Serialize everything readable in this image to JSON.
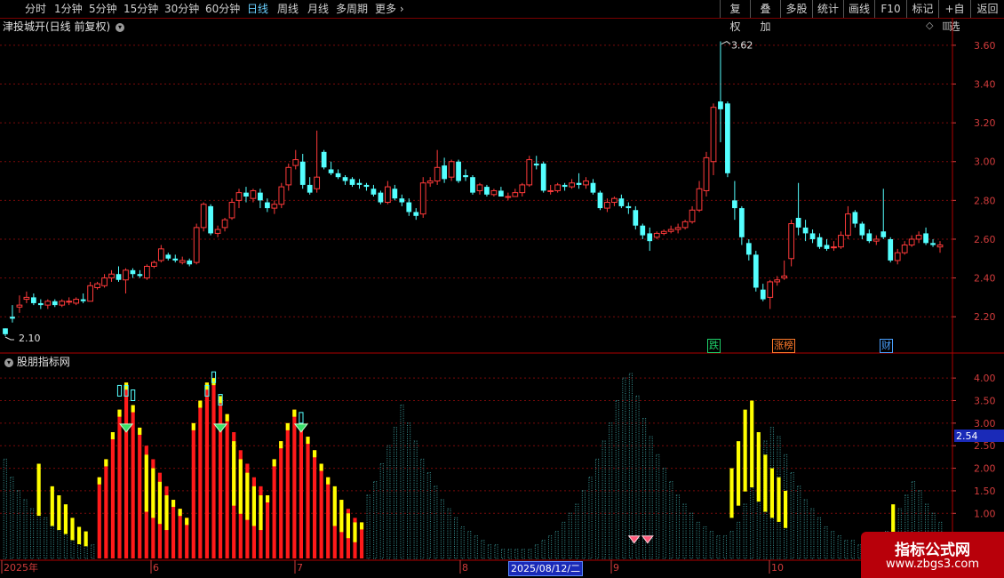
{
  "toolbar": {
    "left": [
      {
        "label": "分时",
        "active": false
      },
      {
        "label": "1分钟",
        "active": false
      },
      {
        "label": "5分钟",
        "active": false
      },
      {
        "label": "15分钟",
        "active": false
      },
      {
        "label": "30分钟",
        "active": false
      },
      {
        "label": "60分钟",
        "active": false
      },
      {
        "label": "日线",
        "active": true
      },
      {
        "label": "周线",
        "active": false
      },
      {
        "label": "月线",
        "active": false
      },
      {
        "label": "多周期",
        "active": false
      },
      {
        "label": "更多",
        "active": false
      }
    ],
    "right": [
      "复权",
      "叠加",
      "多股",
      "统计",
      "画线",
      "F10",
      "标记",
      "+自选",
      "返回"
    ]
  },
  "main_chart": {
    "title": "津投城开(日线 前复权)",
    "high_label": "3.62",
    "low_label": "2.10",
    "events": [
      {
        "text": "跌",
        "color": "#1fd06a"
      },
      {
        "text": "涨榜",
        "color": "#ff7a2a"
      },
      {
        "text": "财",
        "color": "#4aa0ff"
      }
    ]
  },
  "indicator": {
    "title": "股朋指标网",
    "current_value_label": "2.54"
  },
  "chart_data": [
    {
      "type": "candlestick",
      "title": "津投城开(日线 前复权)",
      "ylim": [
        2.1,
        3.65
      ],
      "yticks": [
        2.2,
        2.4,
        2.6,
        2.8,
        3.0,
        3.2,
        3.4,
        3.6
      ],
      "y_tick_labels": [
        "2.20",
        "2.40",
        "2.60",
        "2.80",
        "3.00",
        "3.20",
        "3.40",
        "3.60"
      ],
      "colors": {
        "up": "#ff3a3a",
        "down": "#54ffff"
      },
      "candles": [
        [
          2.14,
          2.14,
          2.11,
          2.1
        ],
        [
          2.2,
          2.26,
          2.19,
          2.17
        ],
        [
          2.25,
          2.31,
          2.26,
          2.22
        ],
        [
          2.29,
          2.33,
          2.3,
          2.27
        ],
        [
          2.3,
          2.32,
          2.27,
          2.26
        ],
        [
          2.27,
          2.29,
          2.26,
          2.24
        ],
        [
          2.26,
          2.29,
          2.28,
          2.24
        ],
        [
          2.28,
          2.29,
          2.26,
          2.25
        ],
        [
          2.26,
          2.29,
          2.28,
          2.25
        ],
        [
          2.28,
          2.3,
          2.28,
          2.26
        ],
        [
          2.27,
          2.3,
          2.29,
          2.26
        ],
        [
          2.29,
          2.32,
          2.28,
          2.27
        ],
        [
          2.28,
          2.38,
          2.36,
          2.28
        ],
        [
          2.35,
          2.38,
          2.37,
          2.34
        ],
        [
          2.36,
          2.42,
          2.4,
          2.35
        ],
        [
          2.4,
          2.44,
          2.42,
          2.38
        ],
        [
          2.42,
          2.46,
          2.39,
          2.38
        ],
        [
          2.39,
          2.45,
          2.44,
          2.32
        ],
        [
          2.44,
          2.45,
          2.42,
          2.4
        ],
        [
          2.42,
          2.44,
          2.41,
          2.4
        ],
        [
          2.4,
          2.47,
          2.46,
          2.39
        ],
        [
          2.46,
          2.49,
          2.48,
          2.45
        ],
        [
          2.49,
          2.57,
          2.55,
          2.48
        ],
        [
          2.52,
          2.53,
          2.5,
          2.49
        ],
        [
          2.5,
          2.52,
          2.49,
          2.48
        ],
        [
          2.48,
          2.51,
          2.49,
          2.47
        ],
        [
          2.49,
          2.5,
          2.47,
          2.46
        ],
        [
          2.48,
          2.68,
          2.66,
          2.47
        ],
        [
          2.66,
          2.79,
          2.78,
          2.64
        ],
        [
          2.77,
          2.78,
          2.63,
          2.62
        ],
        [
          2.63,
          2.67,
          2.65,
          2.61
        ],
        [
          2.66,
          2.71,
          2.7,
          2.64
        ],
        [
          2.71,
          2.81,
          2.79,
          2.7
        ],
        [
          2.8,
          2.86,
          2.84,
          2.76
        ],
        [
          2.84,
          2.87,
          2.82,
          2.79
        ],
        [
          2.81,
          2.86,
          2.85,
          2.79
        ],
        [
          2.84,
          2.86,
          2.8,
          2.76
        ],
        [
          2.79,
          2.81,
          2.76,
          2.74
        ],
        [
          2.76,
          2.8,
          2.78,
          2.73
        ],
        [
          2.78,
          2.89,
          2.87,
          2.76
        ],
        [
          2.88,
          2.99,
          2.97,
          2.85
        ],
        [
          2.98,
          3.06,
          3.01,
          2.96
        ],
        [
          3.0,
          3.04,
          2.88,
          2.86
        ],
        [
          2.88,
          2.92,
          2.84,
          2.83
        ],
        [
          2.86,
          3.16,
          2.92,
          2.84
        ],
        [
          3.05,
          3.06,
          2.97,
          2.96
        ],
        [
          2.96,
          3.0,
          2.94,
          2.93
        ],
        [
          2.94,
          2.96,
          2.92,
          2.91
        ],
        [
          2.92,
          2.93,
          2.9,
          2.88
        ],
        [
          2.91,
          2.92,
          2.88,
          2.87
        ],
        [
          2.89,
          2.91,
          2.88,
          2.86
        ],
        [
          2.88,
          2.89,
          2.87,
          2.85
        ],
        [
          2.86,
          2.88,
          2.83,
          2.82
        ],
        [
          2.84,
          2.85,
          2.79,
          2.78
        ],
        [
          2.79,
          2.9,
          2.87,
          2.78
        ],
        [
          2.86,
          2.88,
          2.81,
          2.8
        ],
        [
          2.81,
          2.83,
          2.79,
          2.77
        ],
        [
          2.79,
          2.81,
          2.74,
          2.72
        ],
        [
          2.74,
          2.76,
          2.72,
          2.7
        ],
        [
          2.73,
          2.92,
          2.89,
          2.71
        ],
        [
          2.89,
          2.92,
          2.9,
          2.87
        ],
        [
          2.9,
          3.06,
          2.97,
          2.88
        ],
        [
          2.98,
          3.02,
          2.91,
          2.89
        ],
        [
          2.92,
          3.01,
          3.0,
          2.9
        ],
        [
          3.0,
          3.01,
          2.9,
          2.89
        ],
        [
          2.93,
          2.96,
          2.92,
          2.9
        ],
        [
          2.92,
          2.93,
          2.84,
          2.83
        ],
        [
          2.85,
          2.89,
          2.88,
          2.83
        ],
        [
          2.87,
          2.88,
          2.83,
          2.82
        ],
        [
          2.83,
          2.86,
          2.85,
          2.82
        ],
        [
          2.85,
          2.87,
          2.82,
          2.82
        ],
        [
          2.82,
          2.84,
          2.82,
          2.8
        ],
        [
          2.82,
          2.86,
          2.84,
          2.82
        ],
        [
          2.84,
          2.89,
          2.88,
          2.82
        ],
        [
          2.88,
          3.03,
          3.01,
          2.87
        ],
        [
          2.99,
          3.03,
          2.98,
          2.96
        ],
        [
          2.99,
          3.0,
          2.85,
          2.84
        ],
        [
          2.85,
          2.88,
          2.85,
          2.83
        ],
        [
          2.85,
          2.89,
          2.88,
          2.84
        ],
        [
          2.88,
          2.89,
          2.87,
          2.85
        ],
        [
          2.87,
          2.91,
          2.89,
          2.86
        ],
        [
          2.89,
          2.94,
          2.88,
          2.86
        ],
        [
          2.88,
          2.92,
          2.9,
          2.86
        ],
        [
          2.89,
          2.91,
          2.84,
          2.83
        ],
        [
          2.84,
          2.85,
          2.76,
          2.75
        ],
        [
          2.76,
          2.81,
          2.79,
          2.74
        ],
        [
          2.79,
          2.82,
          2.81,
          2.77
        ],
        [
          2.81,
          2.83,
          2.77,
          2.76
        ],
        [
          2.77,
          2.79,
          2.76,
          2.73
        ],
        [
          2.75,
          2.77,
          2.67,
          2.65
        ],
        [
          2.67,
          2.68,
          2.62,
          2.6
        ],
        [
          2.63,
          2.66,
          2.59,
          2.54
        ],
        [
          2.61,
          2.64,
          2.63,
          2.6
        ],
        [
          2.63,
          2.65,
          2.64,
          2.62
        ],
        [
          2.64,
          2.67,
          2.65,
          2.63
        ],
        [
          2.65,
          2.68,
          2.66,
          2.63
        ],
        [
          2.66,
          2.7,
          2.69,
          2.65
        ],
        [
          2.69,
          2.77,
          2.75,
          2.68
        ],
        [
          2.75,
          2.9,
          2.86,
          2.74
        ],
        [
          2.85,
          3.05,
          3.02,
          2.82
        ],
        [
          3.0,
          3.3,
          3.28,
          2.93
        ],
        [
          3.31,
          3.62,
          3.27,
          3.1
        ],
        [
          3.3,
          3.31,
          2.94,
          2.92
        ],
        [
          2.8,
          2.9,
          2.76,
          2.7
        ],
        [
          2.76,
          2.77,
          2.61,
          2.57
        ],
        [
          2.58,
          2.6,
          2.52,
          2.49
        ],
        [
          2.52,
          2.54,
          2.35,
          2.33
        ],
        [
          2.34,
          2.37,
          2.29,
          2.28
        ],
        [
          2.3,
          2.39,
          2.38,
          2.24
        ],
        [
          2.38,
          2.41,
          2.39,
          2.36
        ],
        [
          2.4,
          2.49,
          2.41,
          2.39
        ],
        [
          2.5,
          2.7,
          2.68,
          2.46
        ],
        [
          2.71,
          2.89,
          2.66,
          2.62
        ],
        [
          2.66,
          2.7,
          2.63,
          2.59
        ],
        [
          2.63,
          2.65,
          2.6,
          2.58
        ],
        [
          2.61,
          2.63,
          2.56,
          2.55
        ],
        [
          2.57,
          2.6,
          2.55,
          2.54
        ],
        [
          2.56,
          2.59,
          2.56,
          2.54
        ],
        [
          2.56,
          2.64,
          2.62,
          2.55
        ],
        [
          2.62,
          2.77,
          2.73,
          2.6
        ],
        [
          2.74,
          2.75,
          2.68,
          2.66
        ],
        [
          2.68,
          2.69,
          2.62,
          2.6
        ],
        [
          2.63,
          2.65,
          2.59,
          2.58
        ],
        [
          2.59,
          2.62,
          2.6,
          2.57
        ],
        [
          2.64,
          2.86,
          2.61,
          2.6
        ],
        [
          2.6,
          2.61,
          2.49,
          2.48
        ],
        [
          2.49,
          2.55,
          2.53,
          2.47
        ],
        [
          2.53,
          2.59,
          2.57,
          2.52
        ],
        [
          2.57,
          2.62,
          2.6,
          2.56
        ],
        [
          2.6,
          2.64,
          2.62,
          2.58
        ],
        [
          2.63,
          2.66,
          2.58,
          2.57
        ],
        [
          2.58,
          2.6,
          2.57,
          2.56
        ],
        [
          2.56,
          2.59,
          2.57,
          2.53
        ]
      ]
    },
    {
      "type": "bar",
      "title": "股朋指标网",
      "ylim": [
        0,
        4.2
      ],
      "yticks": [
        1.0,
        1.5,
        2.0,
        2.5,
        3.0,
        3.5,
        4.0
      ],
      "y_tick_labels": [
        "1.00",
        "1.50",
        "2.00",
        "2.50",
        "3.00",
        "3.50",
        "4.00"
      ],
      "x_labels": [
        "2025年",
        "6",
        "7",
        "8",
        "9",
        "10"
      ],
      "highlight_date": "2025/08/12/二",
      "values": [
        2.2,
        1.8,
        1.5,
        1.3,
        1.1,
        1.0,
        0.9,
        0.8,
        0.7,
        0.6,
        0.5,
        0.5,
        0.4,
        0.3,
        1.8,
        2.2,
        2.8,
        3.3,
        3.9,
        3.4,
        2.9,
        2.5,
        2.2,
        1.9,
        1.6,
        1.3,
        1.1,
        0.9,
        3.0,
        3.5,
        3.9,
        4.0,
        3.6,
        3.2,
        2.8,
        2.4,
        2.1,
        1.8,
        1.6,
        1.4,
        2.2,
        2.6,
        3.0,
        3.3,
        3.0,
        2.7,
        2.4,
        2.1,
        1.8,
        1.5,
        1.3,
        1.1,
        0.9,
        0.8,
        1.4,
        1.7,
        2.1,
        2.5,
        2.9,
        3.4,
        3.0,
        2.6,
        2.2,
        1.9,
        1.6,
        1.3,
        1.1,
        0.9,
        0.7,
        0.6,
        0.5,
        0.4,
        0.3,
        0.3,
        0.2,
        0.2,
        0.2,
        0.2,
        0.2,
        0.3,
        0.4,
        0.5,
        0.6,
        0.8,
        1.0,
        1.2,
        1.5,
        1.8,
        2.2,
        2.6,
        3.0,
        3.5,
        4.0,
        4.1,
        3.6,
        3.1,
        2.7,
        2.3,
        2.0,
        1.7,
        1.4,
        1.2,
        1.0,
        0.8,
        0.7,
        0.6,
        0.5,
        0.5,
        0.6,
        0.8,
        1.2,
        1.7,
        2.2,
        2.6,
        2.9,
        2.7,
        2.3,
        1.9,
        1.6,
        1.3,
        1.1,
        0.9,
        0.7,
        0.6,
        0.5,
        0.4,
        0.4,
        0.3,
        0.3,
        0.3,
        0.4,
        0.6,
        0.8,
        1.1,
        1.4,
        1.7,
        1.5,
        1.2,
        1.0,
        0.8
      ],
      "red_ranges": [
        [
          14,
          27
        ],
        [
          28,
          39
        ],
        [
          40,
          53
        ]
      ],
      "yellow_values": [
        [
          5,
          2.1
        ],
        [
          7,
          1.6
        ],
        [
          8,
          1.4
        ],
        [
          9,
          1.2
        ],
        [
          10,
          0.9
        ],
        [
          11,
          0.7
        ],
        [
          12,
          0.6
        ],
        [
          21,
          2.3
        ],
        [
          22,
          2.0
        ],
        [
          23,
          1.7
        ],
        [
          24,
          1.4
        ],
        [
          34,
          2.6
        ],
        [
          35,
          2.2
        ],
        [
          36,
          1.9
        ],
        [
          37,
          1.6
        ],
        [
          38,
          1.4
        ],
        [
          49,
          1.6
        ],
        [
          50,
          1.3
        ],
        [
          51,
          1.0
        ],
        [
          52,
          0.8
        ],
        [
          108,
          2.0
        ],
        [
          109,
          2.6
        ],
        [
          110,
          3.3
        ],
        [
          111,
          3.5
        ],
        [
          112,
          2.8
        ],
        [
          113,
          2.3
        ],
        [
          114,
          2.0
        ],
        [
          115,
          1.8
        ],
        [
          116,
          1.5
        ],
        [
          132,
          1.2
        ]
      ],
      "cyan_top_values": [
        [
          17,
          3.6
        ],
        [
          18,
          3.6
        ],
        [
          19,
          3.5
        ],
        [
          30,
          3.6
        ],
        [
          31,
          3.9
        ],
        [
          32,
          3.4
        ],
        [
          44,
          3.0
        ]
      ]
    }
  ]
}
